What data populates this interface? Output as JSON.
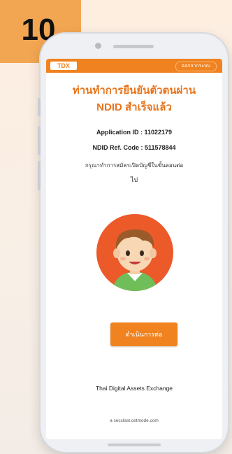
{
  "step_badge": "10",
  "header": {
    "logo": "TDX",
    "link_label": "ออกจากระบบ"
  },
  "main": {
    "title_line1": "ท่านทำการยืนยันตัวตนผ่าน",
    "title_line2": "NDID สำเร็จแล้ว",
    "application_id": "Application ID : 11022179",
    "ndid_ref_code": "NDID Ref. Code : 511578844",
    "message_line1": "กรุณาทำการสมัครเปิดบัญชีในขั้นตอนต่อ",
    "message_line2": "ไป",
    "continue_button": "ดำเนินการต่อ",
    "footer_text": "Thai Digital Assets Exchange",
    "url_text": "a secclast.cetmode.com"
  },
  "colors": {
    "accent": "#f0831f",
    "title": "#e8731a",
    "badge": "#f2a652"
  }
}
